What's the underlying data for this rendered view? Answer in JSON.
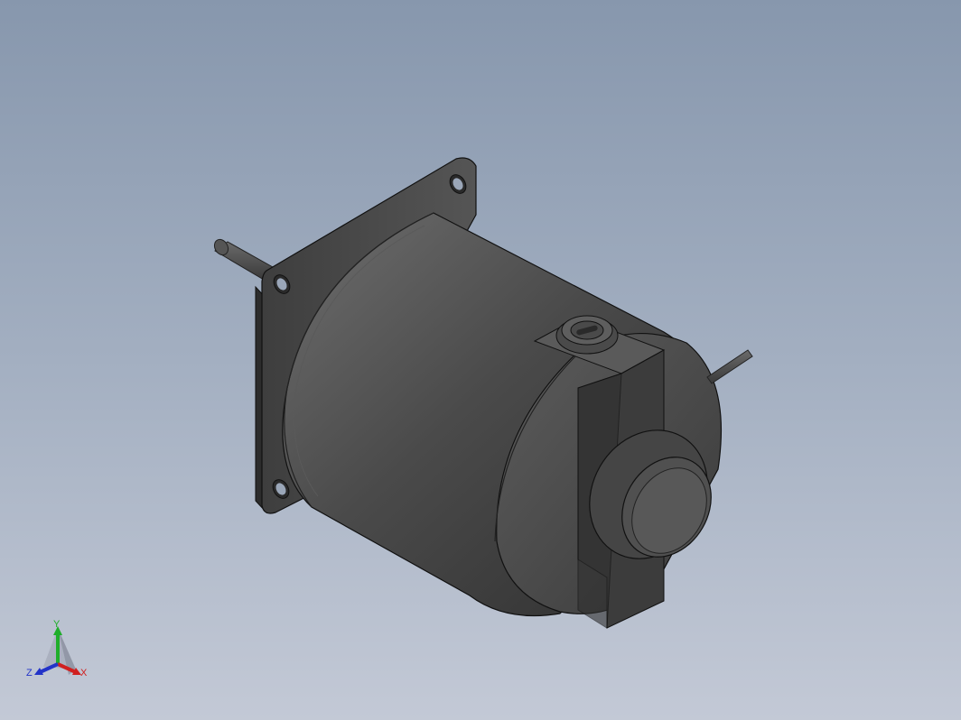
{
  "viewport": {
    "background_top": "#8797ad",
    "background_bottom": "#c3c9d6"
  },
  "model": {
    "part": "solenoid",
    "body_color": "#4a4a4a",
    "edge_color": "#1a1a1a"
  },
  "triad": {
    "x_label": "X",
    "y_label": "Y",
    "z_label": "Z",
    "x_color": "#d02020",
    "y_color": "#1fae2a",
    "z_color": "#2233c8"
  }
}
